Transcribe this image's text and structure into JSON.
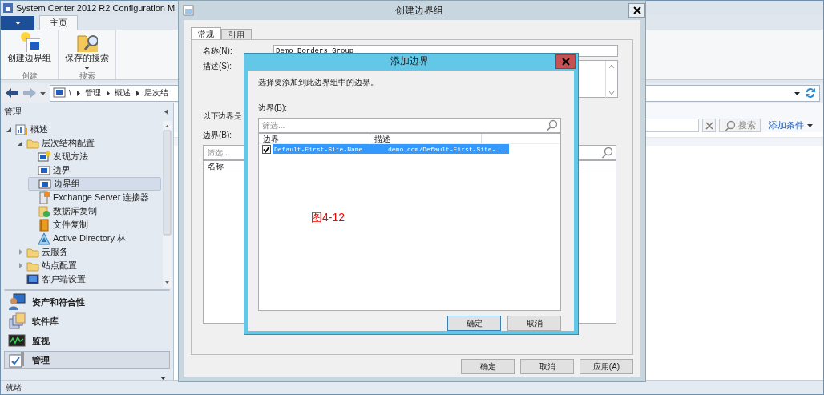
{
  "main_window": {
    "title": "System Center 2012 R2 Configuration M",
    "ribbon_tabs": [
      {
        "label": "主页",
        "selected": true
      }
    ],
    "ribbon_groups": [
      {
        "label": "创建",
        "buttons": [
          {
            "label": "创建边界组",
            "kind": "newgroup",
            "dropdown": false
          }
        ]
      },
      {
        "label": "搜索",
        "buttons": [
          {
            "label": "保存的搜索",
            "kind": "search",
            "dropdown": true
          }
        ]
      }
    ],
    "breadcrumb": [
      "\\",
      "管理",
      "概述",
      "层次结"
    ],
    "navigation": {
      "title": "管理",
      "tree": [
        {
          "label": "概述",
          "kind": "overview",
          "expanded": true,
          "selected": false,
          "children": [
            {
              "label": "层次结构配置",
              "kind": "folder",
              "expanded": true,
              "selected": false,
              "children": [
                {
                  "label": "发现方法",
                  "kind": "discovery",
                  "selected": false
                },
                {
                  "label": "边界",
                  "kind": "boundary",
                  "selected": false
                },
                {
                  "label": "边界组",
                  "kind": "boundary",
                  "selected": true
                },
                {
                  "label": "Exchange Server 连接器",
                  "kind": "connector",
                  "selected": false
                },
                {
                  "label": "数据库复制",
                  "kind": "database",
                  "selected": false
                },
                {
                  "label": "文件复制",
                  "kind": "file",
                  "selected": false
                },
                {
                  "label": "Active Directory 林",
                  "kind": "forest",
                  "selected": false
                }
              ]
            },
            {
              "label": "云服务",
              "kind": "folder",
              "expanded": false,
              "selected": false
            },
            {
              "label": "站点配置",
              "kind": "folder",
              "expanded": false,
              "selected": false
            },
            {
              "label": "客户端设置",
              "kind": "client",
              "selected": false
            }
          ]
        }
      ],
      "workspaces": [
        {
          "label": "资产和符合性",
          "kind": "assets",
          "selected": false
        },
        {
          "label": "软件库",
          "kind": "library",
          "selected": false
        },
        {
          "label": "监视",
          "kind": "monitor",
          "selected": false
        },
        {
          "label": "管理",
          "kind": "admin",
          "selected": true
        }
      ]
    },
    "search": {
      "button": "搜索",
      "add_criteria": "添加条件"
    },
    "status_bar": "就绪"
  },
  "create_dialog": {
    "title": "创建边界组",
    "tabs": [
      {
        "label": "常规",
        "selected": true
      },
      {
        "label": "引用",
        "selected": false
      }
    ],
    "name_label": "名称(N):",
    "name_value": "Demo Borders Group",
    "description_label": "描述(S):",
    "boundaries_note": "以下边界是",
    "boundaries_label": "边界(B):",
    "filter_placeholder": "筛选...",
    "columns": [
      "名称"
    ],
    "buttons": [
      "确定",
      "取消",
      "应用(A)"
    ]
  },
  "add_dialog": {
    "title": "添加边界",
    "instruction": "选择要添加到此边界组中的边界。",
    "boundaries_label": "边界(B):",
    "filter_placeholder": "筛选...",
    "columns": [
      "边界",
      "描述"
    ],
    "rows": [
      {
        "checked": true,
        "selected": true,
        "cells": [
          "Default-First-Site-Name",
          "demo.com/Default-First-Site-..."
        ]
      }
    ],
    "buttons": [
      "确定",
      "取消"
    ]
  },
  "annotation": "图4-12"
}
